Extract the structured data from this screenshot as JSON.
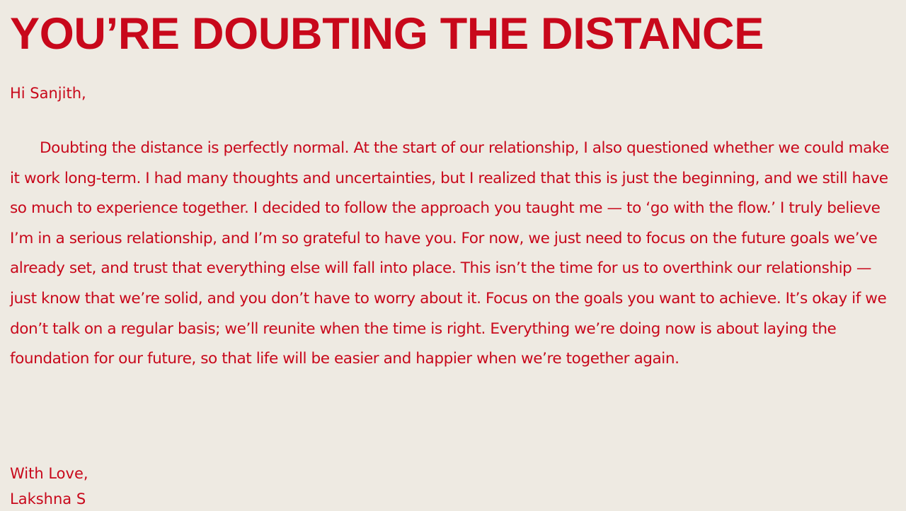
{
  "letter": {
    "title": "YOU’RE DOUBTING THE DISTANCE",
    "greeting": "Hi Sanjith,",
    "body": "Doubting the distance is perfectly normal. At the start of our relationship, I also questioned whether we could make it work long-term. I had many thoughts and uncertainties, but I realized that this is just the beginning, and we still have so much to experience together. I decided to follow the approach you taught me — to ‘go with the flow.’ I truly believe I’m in a serious relationship, and I’m so grateful to have you. For now, we just need to focus on the future goals we’ve already set, and trust that everything else will fall into place. This isn’t the time for us to overthink our relationship — just know that we’re solid, and you don’t have to worry about it. Focus on the goals you want to achieve. It’s okay if we don’t talk on a regular basis; we’ll reunite when the time is right. Everything we’re doing now is about laying the foundation for our future, so that life will be easier and happier when we’re together again.",
    "closing": "With Love,",
    "signature": "Lakshna S"
  },
  "colors": {
    "background": "#EEEAE2",
    "text": "#C8081B"
  }
}
